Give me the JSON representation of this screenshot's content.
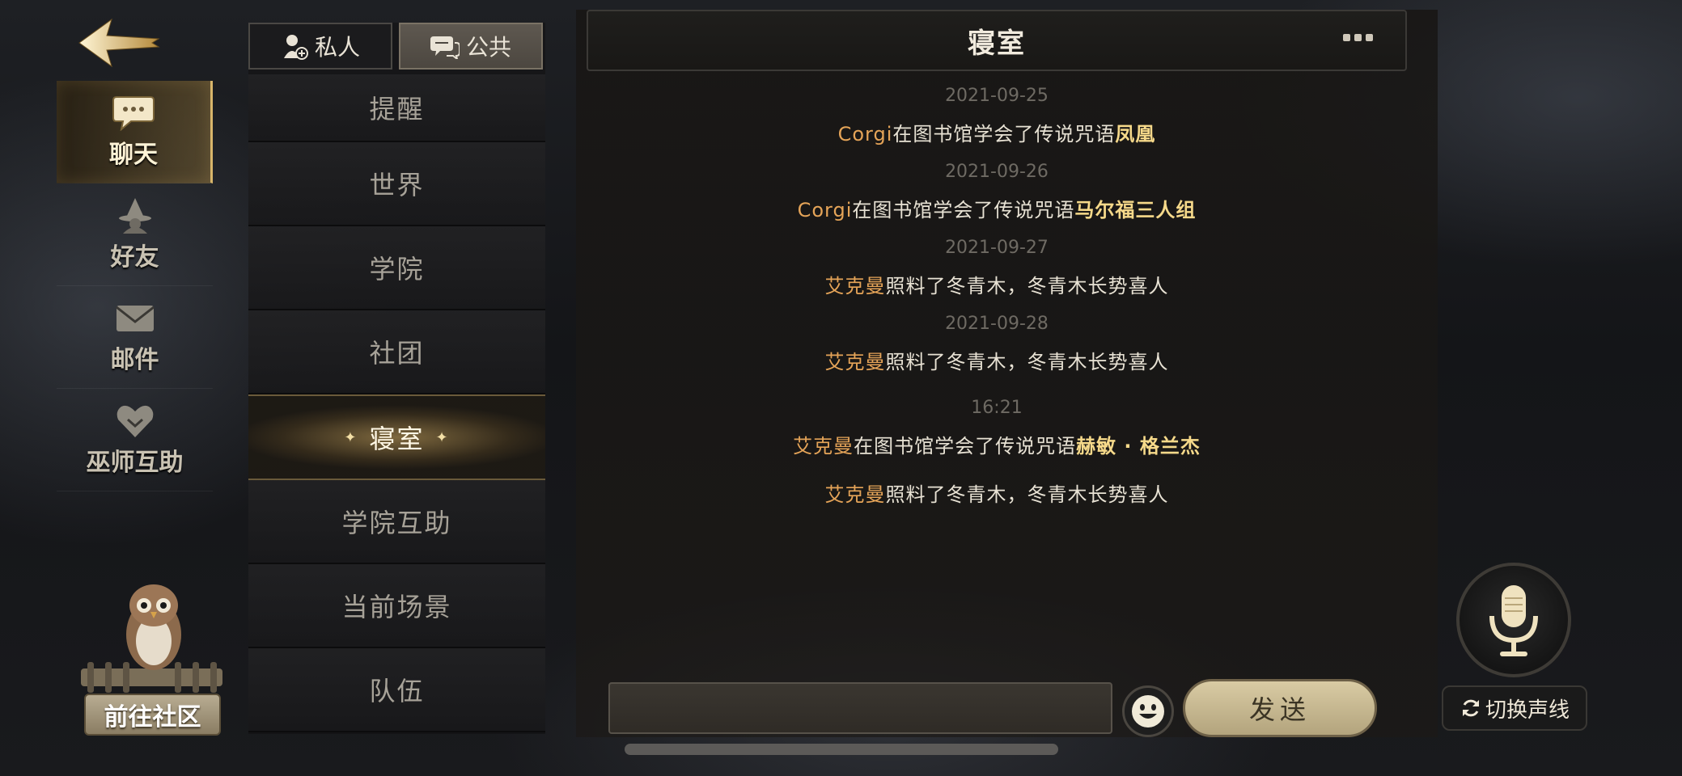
{
  "rail": {
    "items": [
      {
        "label": "聊天",
        "icon": "chat-bubble-icon",
        "active": true
      },
      {
        "label": "好友",
        "icon": "wizard-hat-icon",
        "active": false
      },
      {
        "label": "邮件",
        "icon": "envelope-icon",
        "active": false
      },
      {
        "label": "巫师互助",
        "icon": "heart-shield-icon",
        "active": false
      }
    ],
    "community_label": "前往社区"
  },
  "top_tabs": [
    {
      "label": "私人",
      "icon": "private-chat-icon",
      "active": false
    },
    {
      "label": "公共",
      "icon": "public-chat-icon",
      "active": true
    }
  ],
  "channels": [
    {
      "label": "提醒",
      "active": false
    },
    {
      "label": "世界",
      "active": false
    },
    {
      "label": "学院",
      "active": false
    },
    {
      "label": "社团",
      "active": false
    },
    {
      "label": "寝室",
      "active": true
    },
    {
      "label": "学院互助",
      "active": false
    },
    {
      "label": "当前场景",
      "active": false
    },
    {
      "label": "队伍",
      "active": false
    }
  ],
  "chat": {
    "title": "寝室",
    "messages": [
      {
        "type": "date",
        "text": "2021-09-25"
      },
      {
        "type": "msg",
        "who": "Corgi",
        "text": "在图书馆学会了传说咒语",
        "spell": "凤凰"
      },
      {
        "type": "date",
        "text": "2021-09-26"
      },
      {
        "type": "msg",
        "who": "Corgi",
        "text": "在图书馆学会了传说咒语",
        "spell": "马尔福三人组"
      },
      {
        "type": "date",
        "text": "2021-09-27"
      },
      {
        "type": "msg",
        "who": "艾克曼",
        "text": "照料了冬青木，冬青木长势喜人",
        "spell": ""
      },
      {
        "type": "date",
        "text": "2021-09-28"
      },
      {
        "type": "msg",
        "who": "艾克曼",
        "text": "照料了冬青木，冬青木长势喜人",
        "spell": ""
      },
      {
        "type": "date",
        "text": "16:21"
      },
      {
        "type": "msg",
        "who": "艾克曼",
        "text": "在图书馆学会了传说咒语",
        "spell": "赫敏 · 格兰杰"
      },
      {
        "type": "msg",
        "who": "艾克曼",
        "text": "照料了冬青木，冬青木长势喜人",
        "spell": ""
      }
    ]
  },
  "input": {
    "value": "",
    "send_label": "发送",
    "emoji_icon": "smiley-icon"
  },
  "voice": {
    "mic_icon": "microphone-icon",
    "switch_label": "切换声线",
    "switch_icon": "refresh-icon"
  },
  "colors": {
    "accent_gold": "#e5a458",
    "spell_gold": "#f6d98a",
    "panel_dark": "#1b1b1d"
  }
}
